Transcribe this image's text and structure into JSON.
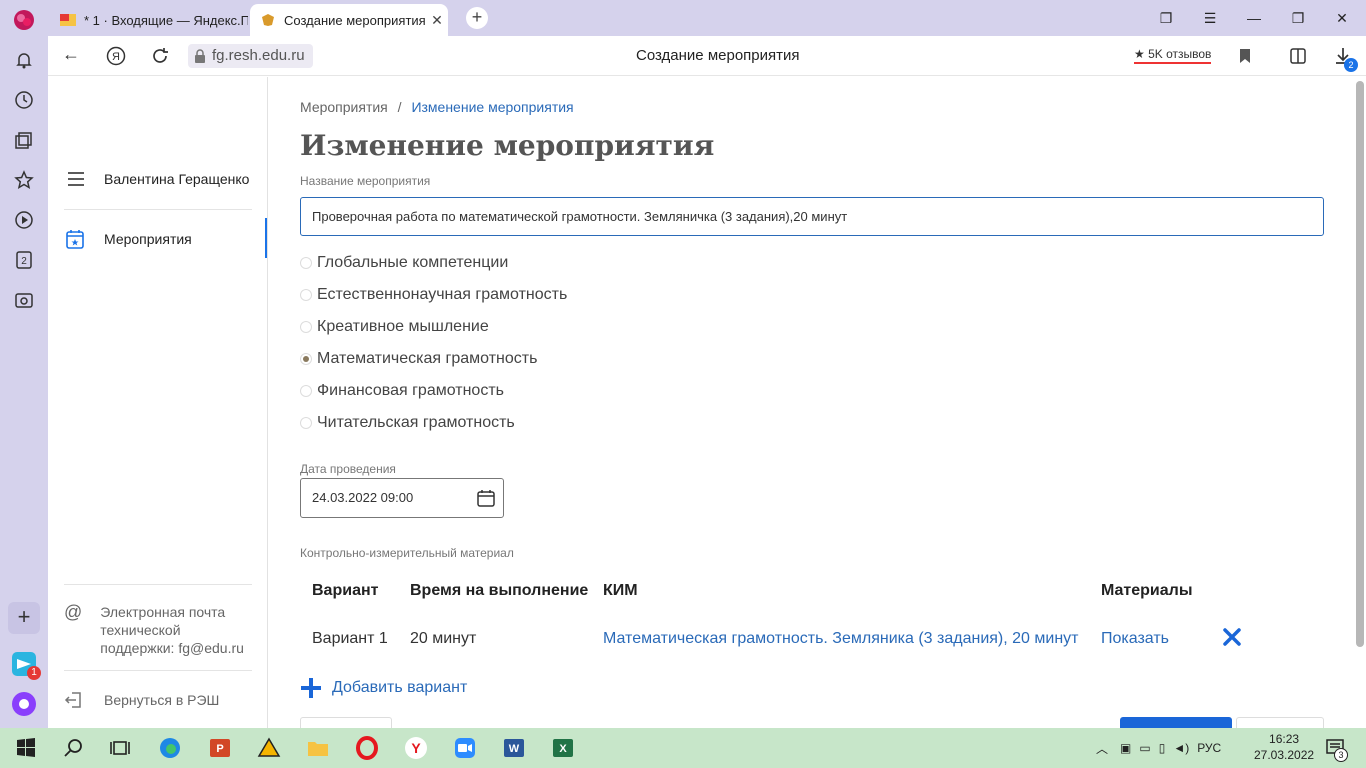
{
  "browser": {
    "tabs": [
      {
        "label": "* 1 · Входящие — Яндекс.П",
        "active": false
      },
      {
        "label": "Создание мероприятия",
        "active": true
      }
    ],
    "address": {
      "url": "fg.resh.edu.ru",
      "page_title": "Создание мероприятия",
      "reviews": "★ 5K отзывов"
    },
    "download_badge": "2",
    "sidebar_badge": "1"
  },
  "app_sidebar": {
    "user_name": "Валентина Геращенко",
    "menu": [
      {
        "label": "Мероприятия",
        "active": true
      }
    ],
    "support": {
      "line1": "Электронная почта",
      "line2": "технической",
      "line3": "поддержки: fg@edu.ru"
    },
    "back_label": "Вернуться в РЭШ"
  },
  "main": {
    "breadcrumb": {
      "root": "Мероприятия",
      "separator": "/",
      "current": "Изменение мероприятия"
    },
    "title": "Изменение мероприятия",
    "name_label": "Название мероприятия",
    "name_value": "Проверочная работа по математической грамотности.  Земляничка (3 задания),20 минут",
    "competences": [
      {
        "label": "Глобальные компетенции",
        "selected": false
      },
      {
        "label": "Естественнонаучная грамотность",
        "selected": false
      },
      {
        "label": "Креативное мышление",
        "selected": false
      },
      {
        "label": "Математическая грамотность",
        "selected": true
      },
      {
        "label": "Финансовая грамотность",
        "selected": false
      },
      {
        "label": "Читательская грамотность",
        "selected": false
      }
    ],
    "date_label": "Дата проведения",
    "date_value": "24.03.2022 09:00",
    "kim_label": "Контрольно-измерительный материал",
    "table": {
      "headers": [
        "Вариант",
        "Время на выполнение",
        "КИМ",
        "Материалы"
      ],
      "rows": [
        {
          "variant": "Вариант 1",
          "time": "20 минут",
          "kim": "Математическая грамотность. Земляника (3 задания), 20 минут",
          "materials": "Показать"
        }
      ]
    },
    "add_variant": "Добавить вариант"
  },
  "taskbar": {
    "language": "РУС",
    "time": "16:23",
    "date": "27.03.2022",
    "notifications": "3"
  },
  "colors": {
    "accent": "#2a6ab8",
    "primary_button": "#1a66d8",
    "browser_chrome": "#d5d2ec",
    "taskbar": "#c7e6c9"
  }
}
